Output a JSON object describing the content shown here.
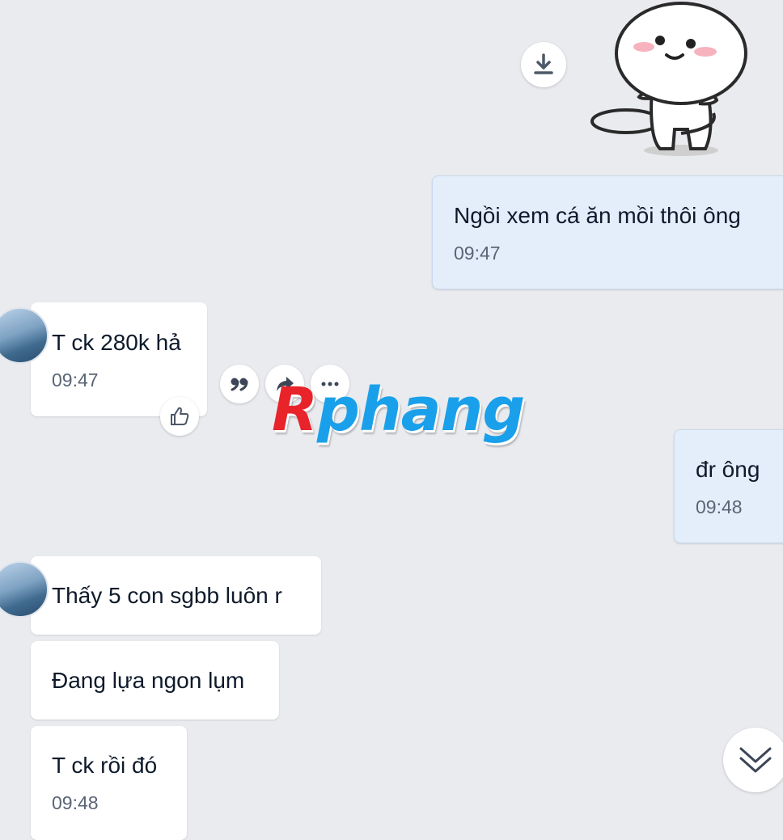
{
  "messages": {
    "out_1": {
      "text": "Ngồi xem cá ăn mồi thôi ông",
      "time": "09:47"
    },
    "in_1": {
      "text": "T ck 280k hả",
      "time": "09:47"
    },
    "out_2": {
      "text": "đr ông",
      "time": "09:48"
    },
    "in_2": {
      "text": "Thấy 5 con sgbb luôn r"
    },
    "in_3": {
      "text": "Đang lựa ngon lụm"
    },
    "in_4": {
      "text": "T ck rồi đó",
      "time": "09:48"
    }
  },
  "watermark": {
    "first": "R",
    "rest": "phang"
  },
  "icons": {
    "download": "download-icon",
    "like": "thumbs-up-icon",
    "quote": "quote-icon",
    "forward": "forward-icon",
    "more": "more-icon",
    "scroll": "double-chevron-down-icon"
  },
  "colors": {
    "background": "#eaebef",
    "incoming_bubble": "#ffffff",
    "outgoing_bubble": "#e4eefb",
    "watermark_red": "#e8232a",
    "watermark_blue": "#1aa0ea"
  }
}
